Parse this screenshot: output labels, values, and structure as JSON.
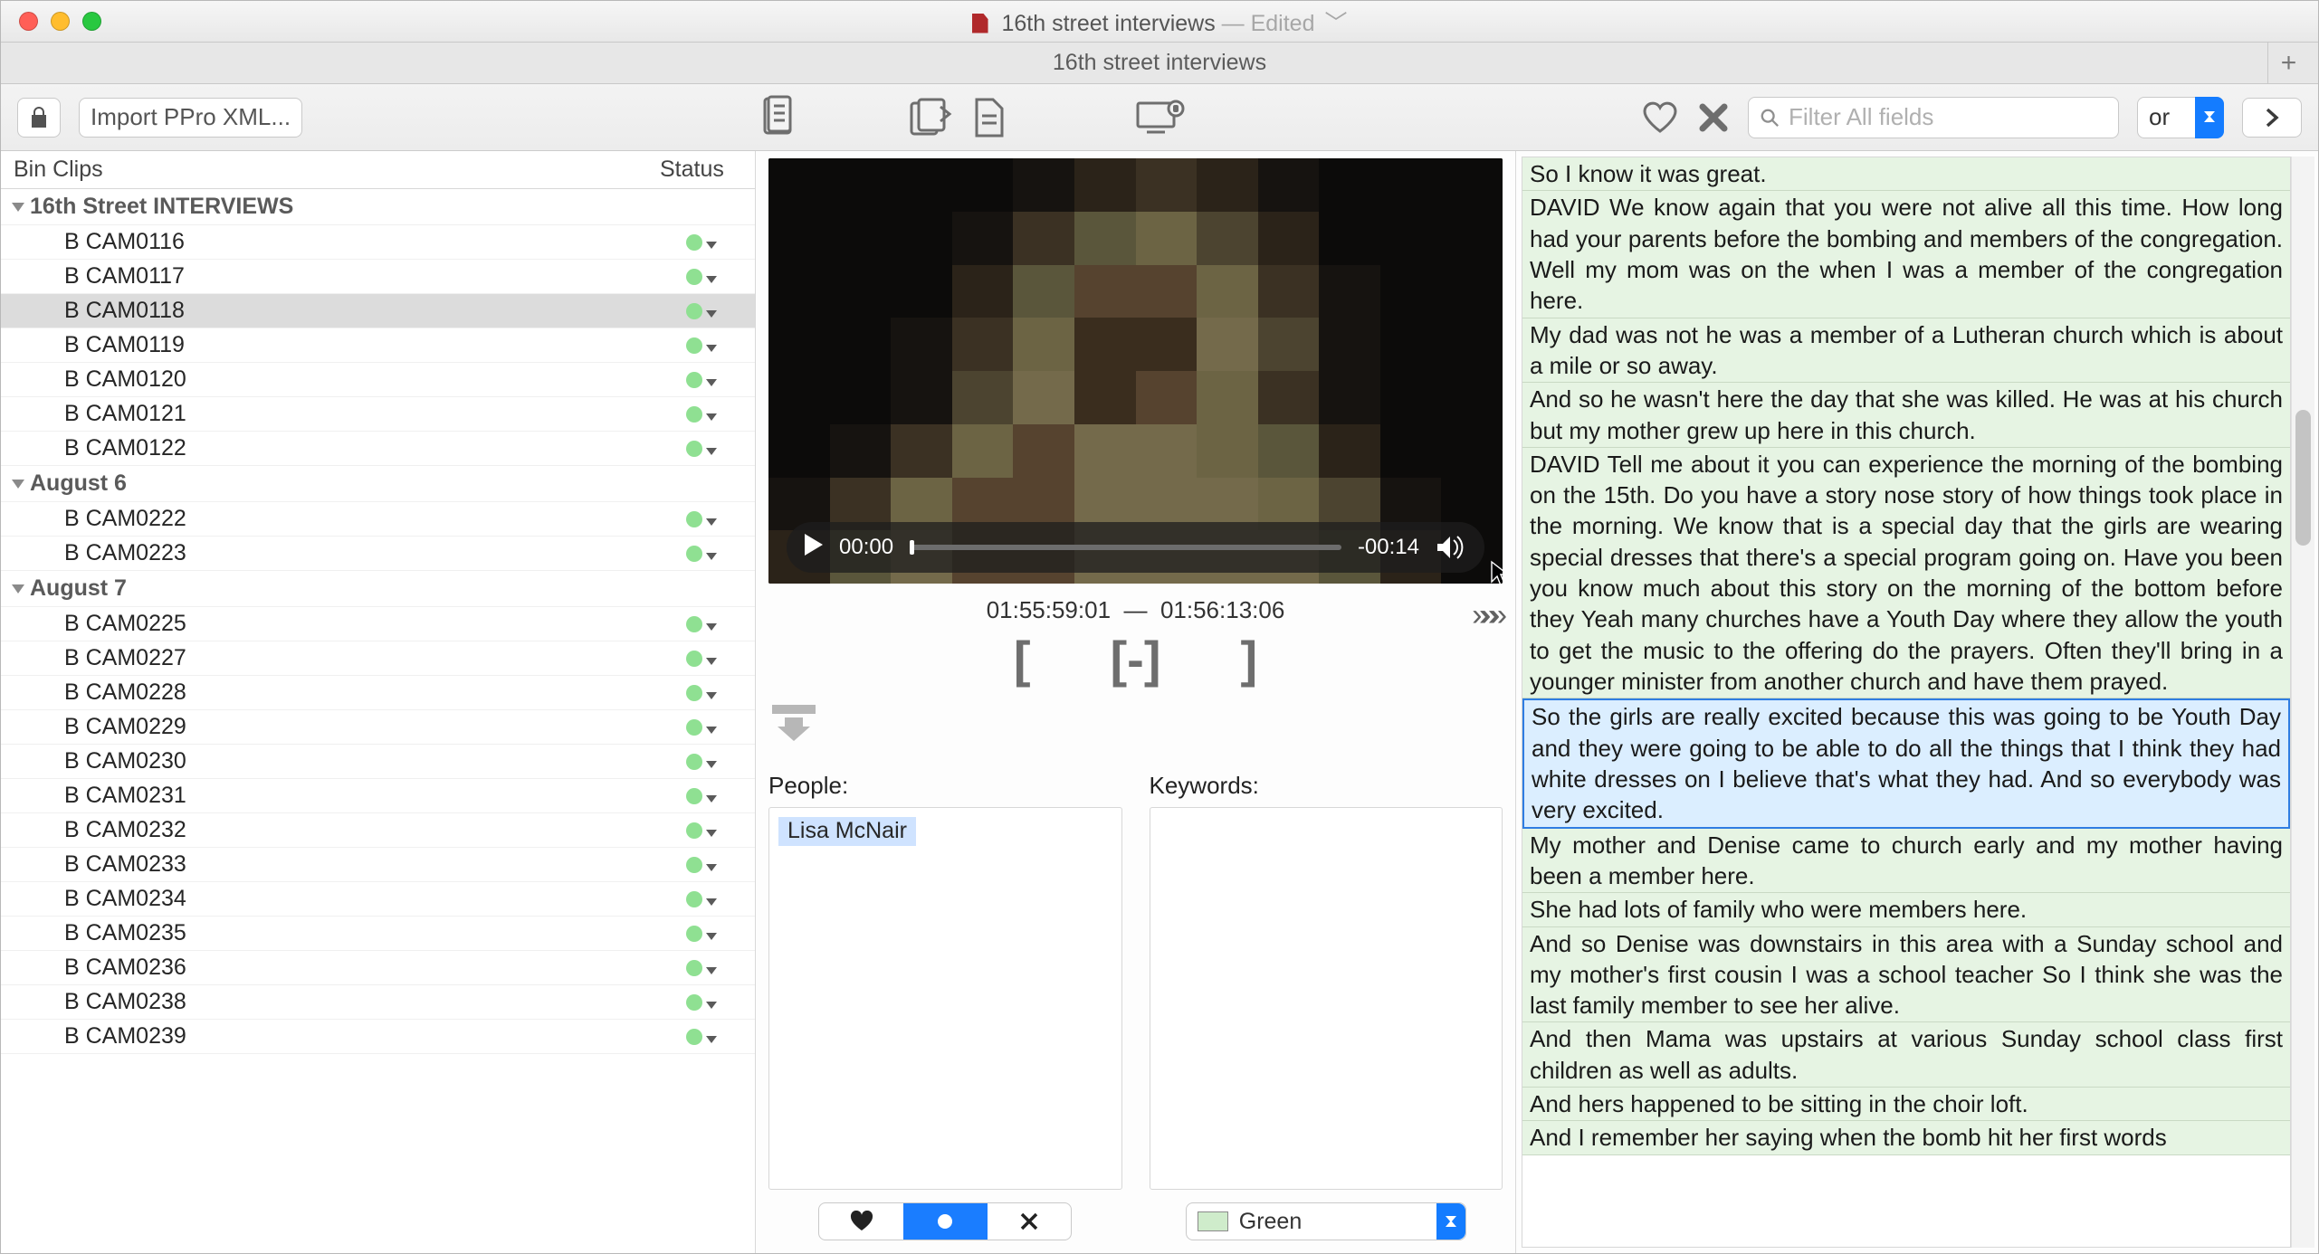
{
  "window": {
    "doc_title": "16th street interviews",
    "edited_suffix": " — Edited",
    "tab_name": "16th street interviews"
  },
  "toolbar": {
    "import_label": "Import PPro XML...",
    "search_placeholder": "Filter All fields",
    "logic_label": "or"
  },
  "sidebar": {
    "col_bin": "Bin Clips",
    "col_status": "Status",
    "groups": [
      {
        "name": "16th Street INTERVIEWS",
        "clips": [
          "B CAM0116",
          "B CAM0117",
          "B CAM0118",
          "B CAM0119",
          "B CAM0120",
          "B CAM0121",
          "B CAM0122"
        ],
        "selected_index": 2
      },
      {
        "name": "August 6",
        "clips": [
          "B CAM0222",
          "B CAM0223"
        ],
        "selected_index": -1
      },
      {
        "name": "August 7",
        "clips": [
          "B CAM0225",
          "B CAM0227",
          "B CAM0228",
          "B CAM0229",
          "B CAM0230",
          "B CAM0231",
          "B CAM0232",
          "B CAM0233",
          "B CAM0234",
          "B CAM0235",
          "B CAM0236",
          "B CAM0238",
          "B CAM0239"
        ],
        "selected_index": -1
      }
    ]
  },
  "player": {
    "elapsed": "00:00",
    "remaining": "-00:14",
    "tc_in": "01:55:59:01",
    "tc_out": "01:56:13:06"
  },
  "meta": {
    "people_label": "People:",
    "keywords_label": "Keywords:",
    "person_tag": "Lisa McNair",
    "color_value": "Green"
  },
  "transcript": [
    "So I know it was great.",
    "DAVID We know again that you were not alive all this time. How long had your parents before the bombing and members of the congregation. Well my mom was on the when I was a member of the congregation here.",
    "My dad was not he was a member of a Lutheran church which is about a mile or so away.",
    "And so he wasn't here the day that she was killed. He was at his church but my mother grew up here in this church.",
    "DAVID Tell me about it you can experience the morning of the bombing on the 15th. Do you have a story nose story of how things took place in the morning. We know that is a special day that the girls are wearing special dresses that there's a special program going on. Have you been you know much about this story on the morning of the bottom before they Yeah many churches have a Youth Day where they allow the youth to get the music to the offering do the prayers. Often they'll bring in a younger minister from another church and have them prayed.",
    "So the girls are really excited because this was going to be Youth Day and they were going to be able to do all the things that I think they had white dresses on I believe that's what they had. And so everybody was very excited.",
    "My mother and Denise came to church early and my mother having been a member here.",
    "She had lots of family who were members here.",
    "And so Denise was downstairs in this area with a Sunday school and my mother's first cousin I was a school teacher So I think she was the last family member to see her alive.",
    "And then Mama was upstairs at various Sunday school class first children as well as adults.",
    "And hers happened to be sitting in the choir loft.",
    "And I remember her saying when the bomb hit her first words"
  ],
  "transcript_highlight_index": 5
}
